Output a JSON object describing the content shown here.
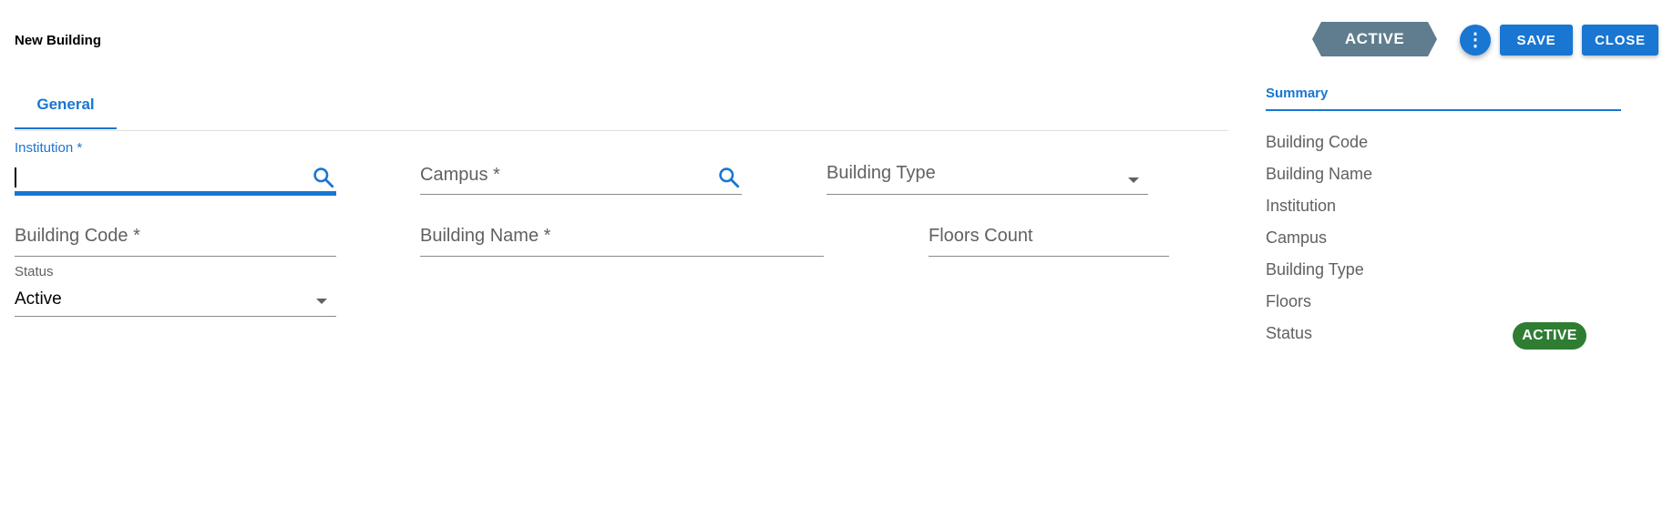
{
  "header": {
    "title": "New Building",
    "status_chip": "ACTIVE",
    "more_icon": "more-vert-icon",
    "save_label": "SAVE",
    "close_label": "CLOSE"
  },
  "tabs": [
    {
      "label": "General",
      "active": true
    }
  ],
  "form": {
    "institution": {
      "label": "Institution *",
      "value": "",
      "focused": true,
      "icon": "search-icon"
    },
    "campus": {
      "label": "Campus *",
      "value": "",
      "icon": "search-icon"
    },
    "building_type": {
      "label": "Building Type",
      "value": "",
      "icon": "dropdown-arrow-icon"
    },
    "building_code": {
      "label": "Building Code *",
      "value": ""
    },
    "building_name": {
      "label": "Building Name *",
      "value": ""
    },
    "floors_count": {
      "label": "Floors Count",
      "value": ""
    },
    "status": {
      "label": "Status",
      "value": "Active",
      "icon": "dropdown-arrow-icon"
    }
  },
  "summary": {
    "title": "Summary",
    "items": [
      {
        "label": "Building Code"
      },
      {
        "label": "Building Name"
      },
      {
        "label": "Institution"
      },
      {
        "label": "Campus"
      },
      {
        "label": "Building Type"
      },
      {
        "label": "Floors"
      },
      {
        "label": "Status"
      }
    ],
    "status_badge": "ACTIVE"
  },
  "colors": {
    "primary": "#1976d2",
    "status_chip": "#5f7d8e",
    "active_badge": "#2e7d32",
    "text_muted": "#616161"
  }
}
